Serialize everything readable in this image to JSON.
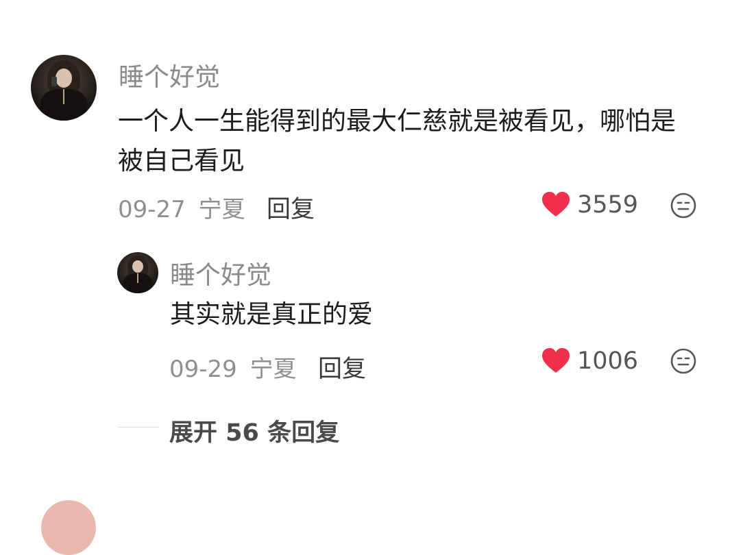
{
  "comments": [
    {
      "username": "睡个好觉",
      "text": "一个人一生能得到的最大仁慈就是被看见，哪怕是被自己看见",
      "date": "09-27",
      "location": "宁夏",
      "reply_label": "回复",
      "like_count": "3559",
      "icons": {
        "like": "heart-icon",
        "react": "emoji-icon"
      },
      "colors": {
        "heart": "#f0304a"
      }
    }
  ],
  "replies": [
    {
      "username": "睡个好觉",
      "text": "其实就是真正的爱",
      "date": "09-29",
      "location": "宁夏",
      "reply_label": "回复",
      "like_count": "1006"
    }
  ],
  "expand": {
    "label": "展开 56 条回复"
  }
}
